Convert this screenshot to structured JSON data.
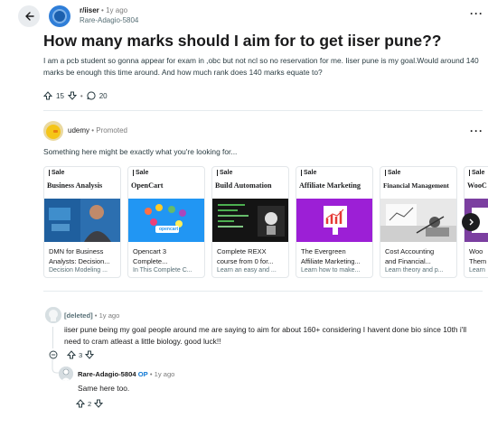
{
  "header": {
    "subreddit": "r/iiser",
    "dot": "•",
    "time": "1y ago",
    "author": "Rare-Adagio-5804",
    "more": "···"
  },
  "post": {
    "title": "How many marks should I aim for to get iiser pune??",
    "body": "I am a pcb student so gonna appear for exam in ,obc but not ncl so no reservation for me. Iiser pune is my goal.Would around 140 marks be enough this time around. And how much rank does 140 marks equate to?",
    "votes": "15",
    "comments": "20"
  },
  "promo": {
    "advertiser": "udemy",
    "dot": "•",
    "label": "Promoted",
    "more": "···",
    "text": "Something here might be exactly what you're looking for...",
    "cards": [
      {
        "sale": "Sale",
        "title": "Business Analysis",
        "line1": "DMN for Business",
        "line2": "Analysts: Decision...",
        "line3": "Decision Modeling ..."
      },
      {
        "sale": "Sale",
        "title": "OpenCart",
        "line1": "Opencart 3",
        "line2": "Complete...",
        "line3": "In This Complete C..."
      },
      {
        "sale": "Sale",
        "title": "Build Automation",
        "line1": "Complete REXX",
        "line2": "course from 0 for...",
        "line3": "Learn an easy and ..."
      },
      {
        "sale": "Sale",
        "title": "Affiliate Marketing",
        "line1": "The Evergreen",
        "line2": "Affiliate Marketing...",
        "line3": "Learn how to make..."
      },
      {
        "sale": "Sale",
        "title": "Financial Management",
        "line1": "Cost Accounting",
        "line2": "and Financial...",
        "line3": "Learn theory and p..."
      },
      {
        "sale": "Sale",
        "title": "WooC",
        "line1": "Woo",
        "line2": "Them",
        "line3": "Learn"
      }
    ],
    "opencart_badge": "opencart"
  },
  "comments": [
    {
      "author": "[deleted]",
      "dot": "•",
      "time": "1y ago",
      "text": "iiser pune being my goal people around me are saying to aim for about 160+ considering I havent done bio since 10th i'll need to cram atleast a little biology. good luck!!",
      "collapse": "⊖",
      "votes": "3"
    },
    {
      "author": "Rare-Adagio-5804",
      "op": "OP",
      "dot": "•",
      "time": "1y ago",
      "text": "Same here too.",
      "votes": "2"
    }
  ],
  "colors": {
    "accent_blue": "#0f78d4",
    "card_blue": "#2196f3",
    "card_purple": "#9c1fd6"
  }
}
